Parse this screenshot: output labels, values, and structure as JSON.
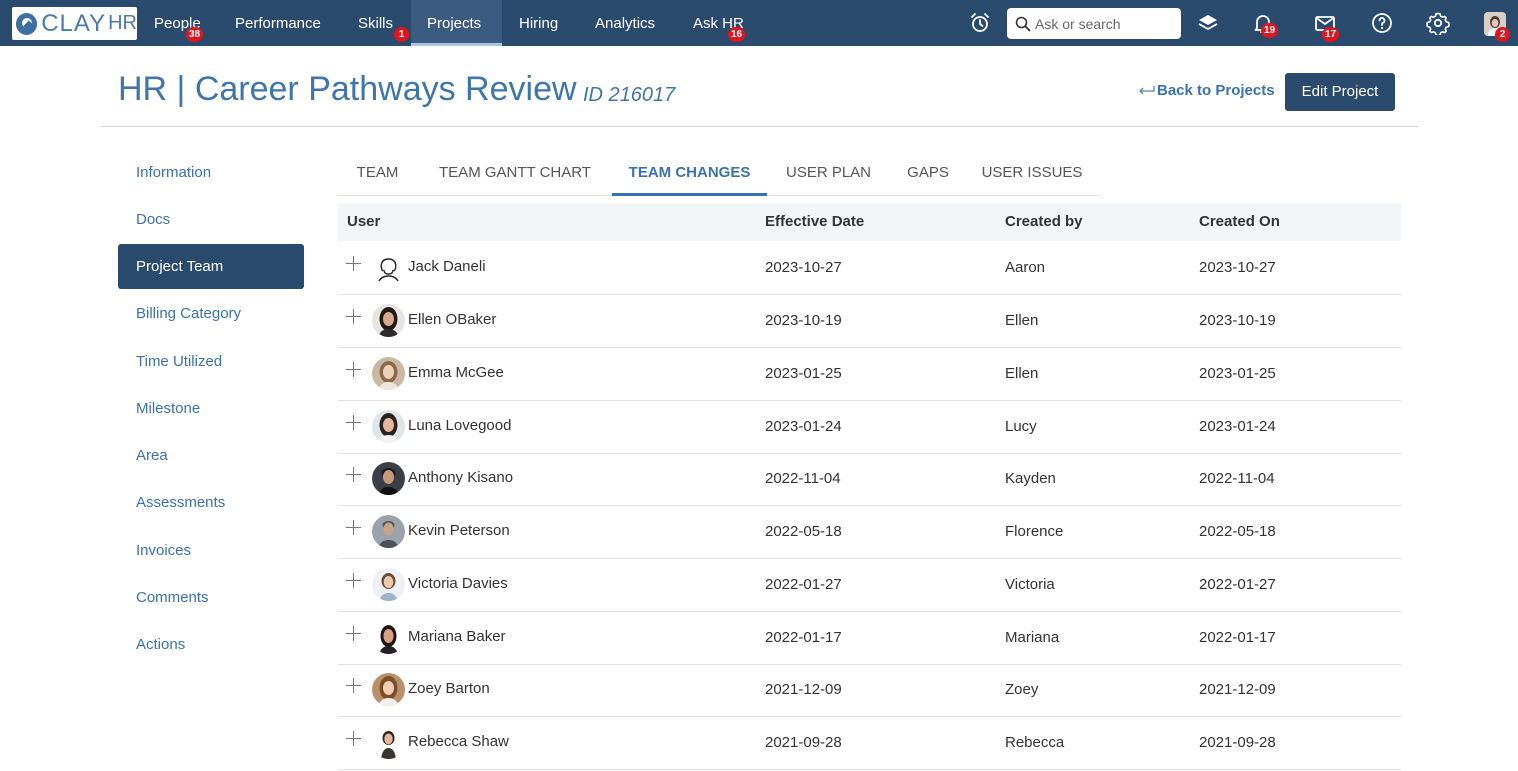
{
  "brand": {
    "name_main": "CLAY",
    "name_suffix": "HR"
  },
  "nav": {
    "items": [
      {
        "label": "People",
        "badge": "38"
      },
      {
        "label": "Performance",
        "badge": ""
      },
      {
        "label": "Skills",
        "badge": "1"
      },
      {
        "label": "Projects",
        "badge": ""
      },
      {
        "label": "Hiring",
        "badge": ""
      },
      {
        "label": "Analytics",
        "badge": ""
      },
      {
        "label": "Ask HR",
        "badge": "16"
      }
    ],
    "search_placeholder": "Ask or search",
    "notifications_badge": "19",
    "messages_badge": "17",
    "profile_badge": "2"
  },
  "header": {
    "title": "HR | Career Pathways Review",
    "id_label": "ID 216017",
    "back_label": "Back to Projects",
    "edit_label": "Edit Project"
  },
  "sidebar": {
    "items": [
      {
        "label": "Information"
      },
      {
        "label": "Docs"
      },
      {
        "label": "Project Team",
        "active": true
      },
      {
        "label": "Billing Category"
      },
      {
        "label": "Time Utilized"
      },
      {
        "label": "Milestone"
      },
      {
        "label": "Area"
      },
      {
        "label": "Assessments"
      },
      {
        "label": "Invoices"
      },
      {
        "label": "Comments"
      },
      {
        "label": "Actions"
      }
    ]
  },
  "tabs": [
    {
      "label": "TEAM"
    },
    {
      "label": "TEAM GANTT CHART"
    },
    {
      "label": "TEAM CHANGES",
      "active": true
    },
    {
      "label": "USER PLAN"
    },
    {
      "label": "GAPS"
    },
    {
      "label": "USER ISSUES"
    }
  ],
  "table": {
    "columns": [
      "User",
      "Effective Date",
      "Created by",
      "Created On"
    ],
    "rows": [
      {
        "user": "Jack Daneli",
        "effective": "2023-10-27",
        "created_by": "Aaron",
        "created_on": "2023-10-27"
      },
      {
        "user": "Ellen OBaker",
        "effective": "2023-10-19",
        "created_by": "Ellen",
        "created_on": "2023-10-19"
      },
      {
        "user": "Emma McGee",
        "effective": "2023-01-25",
        "created_by": "Ellen",
        "created_on": "2023-01-25"
      },
      {
        "user": "Luna Lovegood",
        "effective": "2023-01-24",
        "created_by": "Lucy",
        "created_on": "2023-01-24"
      },
      {
        "user": "Anthony Kisano",
        "effective": "2022-11-04",
        "created_by": "Kayden",
        "created_on": "2022-11-04"
      },
      {
        "user": "Kevin Peterson",
        "effective": "2022-05-18",
        "created_by": "Florence",
        "created_on": "2022-05-18"
      },
      {
        "user": "Victoria Davies",
        "effective": "2022-01-27",
        "created_by": "Victoria",
        "created_on": "2022-01-27"
      },
      {
        "user": "Mariana Baker",
        "effective": "2022-01-17",
        "created_by": "Mariana",
        "created_on": "2022-01-17"
      },
      {
        "user": "Zoey Barton",
        "effective": "2021-12-09",
        "created_by": "Zoey",
        "created_on": "2021-12-09"
      },
      {
        "user": "Rebecca Shaw",
        "effective": "2021-09-28",
        "created_by": "Rebecca",
        "created_on": "2021-09-28"
      }
    ]
  },
  "colors": {
    "nav_bg": "#2a4a6e",
    "accent": "#3a72b0",
    "badge": "#e0161f"
  }
}
